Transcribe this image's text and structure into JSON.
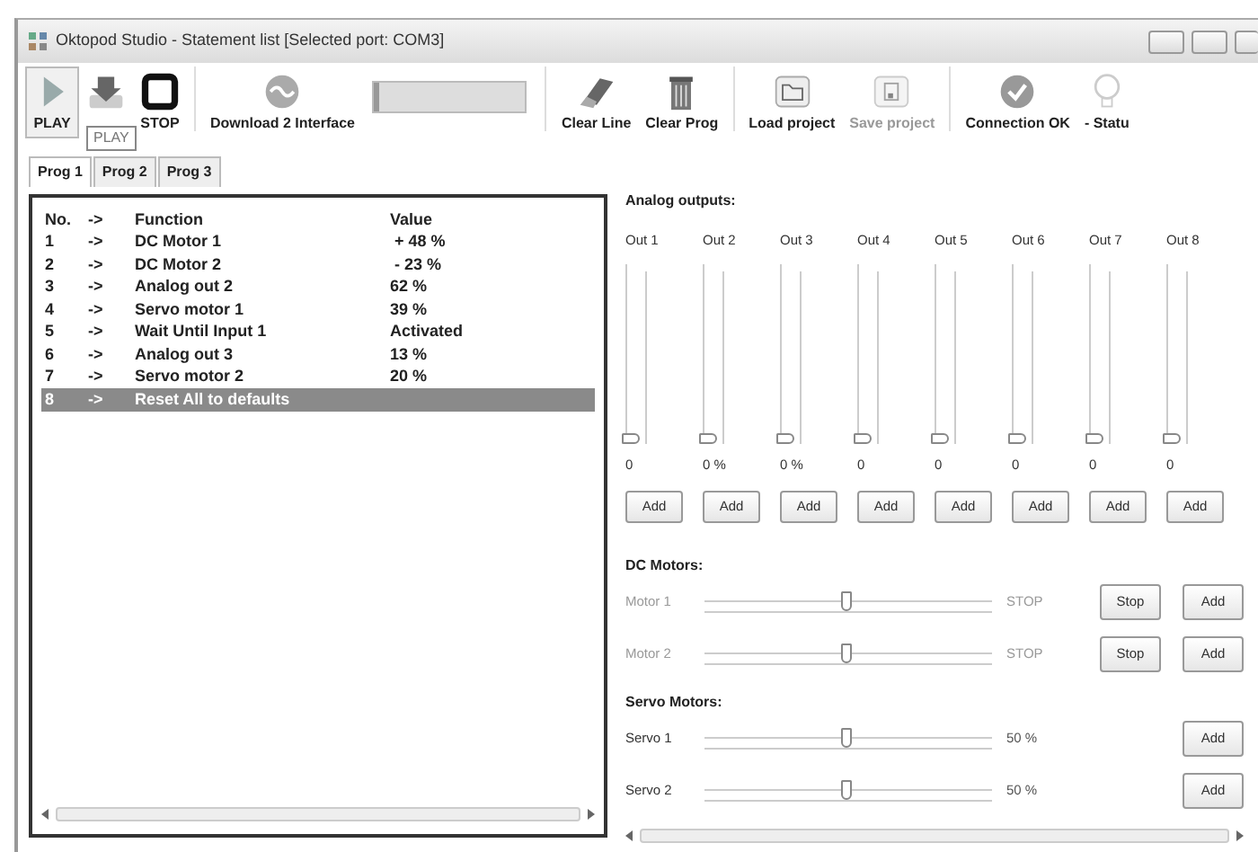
{
  "window": {
    "title": "Oktopod Studio - Statement list [Selected port: COM3]"
  },
  "toolbar": {
    "buttons": [
      {
        "kind": "play",
        "label": "PLAY",
        "disabled": false,
        "pressed": true
      },
      {
        "kind": "download",
        "disabled": false,
        "pressed": false
      },
      {
        "kind": "stop",
        "label": "STOP",
        "disabled": false,
        "pressed": false
      },
      {
        "kind": "interface",
        "label": "Download 2 Interface",
        "disabled": false,
        "pressed": false
      },
      {
        "kind": "progress",
        "level": 0.03
      },
      {
        "kind": "eraser",
        "label": "Clear Line",
        "disabled": false,
        "pressed": false
      },
      {
        "kind": "trash",
        "label": "Clear Prog",
        "disabled": false,
        "pressed": false
      },
      {
        "kind": "folder",
        "label": "Load project",
        "disabled": false,
        "pressed": false
      },
      {
        "kind": "floppy",
        "label": "Save project",
        "disabled": true,
        "pressed": false
      },
      {
        "kind": "check",
        "label": "Connection OK",
        "disabled": false,
        "pressed": false
      },
      {
        "kind": "bulb",
        "label": "- Statu",
        "disabled": false,
        "pressed": false
      }
    ],
    "tooltip": "PLAY"
  },
  "tabs": [
    {
      "label": "Prog 1",
      "selected": true
    },
    {
      "label": "Prog 2",
      "selected": false
    },
    {
      "label": "Prog 3",
      "selected": false
    }
  ],
  "statements": {
    "columns": [
      "No.",
      "->",
      "Function",
      "Value"
    ],
    "rows": [
      {
        "no": "1",
        "arrow": "->",
        "function": "DC Motor 1",
        "value": " + 48 %",
        "selected": false
      },
      {
        "no": "2",
        "arrow": "->",
        "function": "DC Motor 2",
        "value": " - 23 %",
        "selected": false
      },
      {
        "no": "3",
        "arrow": "->",
        "function": "Analog out 2",
        "value": "62 %",
        "selected": false
      },
      {
        "no": "4",
        "arrow": "->",
        "function": "Servo motor 1",
        "value": "39 %",
        "selected": false
      },
      {
        "no": "5",
        "arrow": "->",
        "function": "Wait Until Input 1",
        "value": "Activated",
        "selected": false
      },
      {
        "no": "6",
        "arrow": "->",
        "function": "Analog out 3",
        "value": "13 %",
        "selected": false
      },
      {
        "no": "7",
        "arrow": "->",
        "function": "Servo motor 2",
        "value": "20 %",
        "selected": false
      },
      {
        "no": "8",
        "arrow": "->",
        "function": "Reset All to defaults",
        "value": "",
        "selected": true
      }
    ]
  },
  "analog_outputs": {
    "title": "Analog outputs:",
    "channels": [
      {
        "label": "Out 1",
        "level": 0,
        "reading": "0",
        "button": "Add"
      },
      {
        "label": "Out 2",
        "level": 0,
        "reading": "0 %",
        "button": "Add"
      },
      {
        "label": "Out 3",
        "level": 0,
        "reading": "0 %",
        "button": "Add"
      },
      {
        "label": "Out 4",
        "level": 0,
        "reading": "0",
        "button": "Add"
      },
      {
        "label": "Out 5",
        "level": 0,
        "reading": "0",
        "button": "Add"
      },
      {
        "label": "Out 6",
        "level": 0,
        "reading": "0",
        "button": "Add"
      },
      {
        "label": "Out 7",
        "level": 0,
        "reading": "0",
        "button": "Add"
      },
      {
        "label": "Out 8",
        "level": 0,
        "reading": "0",
        "button": "Add"
      }
    ]
  },
  "dc_motors": {
    "title": "DC Motors:",
    "motors": [
      {
        "label": "Motor 1",
        "level": 0.5,
        "reading": "STOP",
        "stop_button": "Stop",
        "add_button": "Add",
        "disabled": true
      },
      {
        "label": "Motor 2",
        "level": 0.5,
        "reading": "STOP",
        "stop_button": "Stop",
        "add_button": "Add",
        "disabled": true
      }
    ]
  },
  "servo_motors": {
    "title": "Servo Motors:",
    "motors": [
      {
        "label": "Servo 1",
        "level": 0.5,
        "reading": "50 %",
        "add_button": "Add",
        "disabled": false
      },
      {
        "label": "Servo 2",
        "level": 0.5,
        "reading": "50 %",
        "add_button": "Add",
        "disabled": false
      }
    ]
  }
}
